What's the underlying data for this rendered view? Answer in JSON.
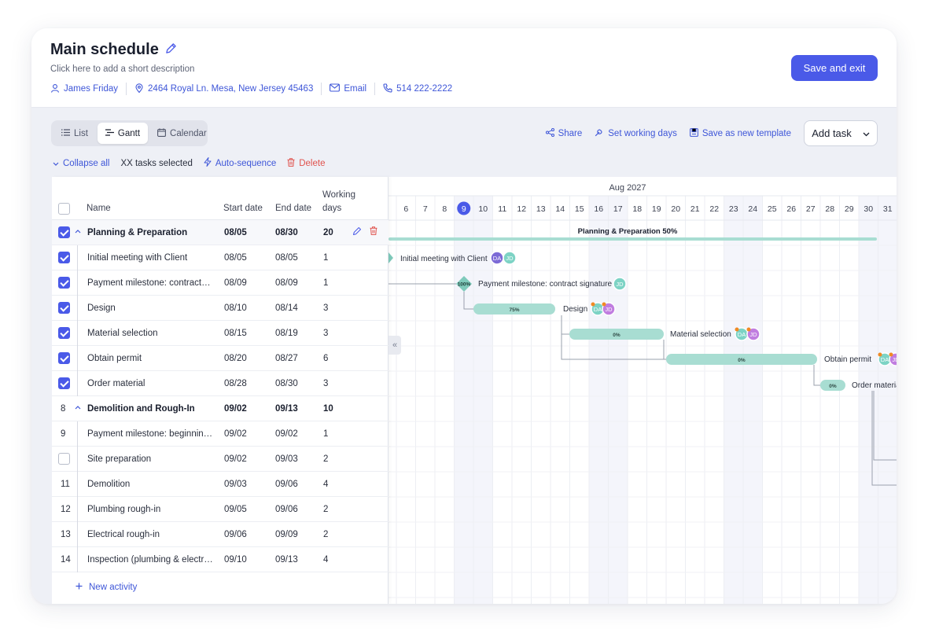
{
  "header": {
    "title": "Main schedule",
    "description": "Click here to add a short description",
    "contact_name": "James Friday",
    "address": "2464 Royal Ln. Mesa, New Jersey 45463",
    "email": "Email",
    "phone": "514 222-2222",
    "save_exit": "Save and exit"
  },
  "views": {
    "list": "List",
    "gantt": "Gantt",
    "calendar": "Calendar"
  },
  "toolbar": {
    "share": "Share",
    "working_days": "Set working days",
    "save_template": "Save as new template",
    "add_task": "Add task"
  },
  "subbar": {
    "collapse_all": "Collapse all",
    "selected": "XX tasks selected",
    "auto_sequence": "Auto-sequence",
    "delete": "Delete"
  },
  "table": {
    "col_name": "Name",
    "col_start": "Start date",
    "col_end": "End date",
    "col_working_1": "Working",
    "col_working_2": "days",
    "new_activity": "New activity",
    "rows": [
      {
        "num": "",
        "name": "Planning & Preparation",
        "start": "08/05",
        "end": "08/30",
        "days": "20"
      },
      {
        "num": "",
        "name": "Initial meeting with Client",
        "start": "08/05",
        "end": "08/05",
        "days": "1"
      },
      {
        "num": "",
        "name": "Payment milestone: contract…",
        "start": "08/09",
        "end": "08/09",
        "days": "1"
      },
      {
        "num": "",
        "name": "Design",
        "start": "08/10",
        "end": "08/14",
        "days": "3"
      },
      {
        "num": "",
        "name": "Material selection",
        "start": "08/15",
        "end": "08/19",
        "days": "3"
      },
      {
        "num": "",
        "name": "Obtain permit",
        "start": "08/20",
        "end": "08/27",
        "days": "6"
      },
      {
        "num": "",
        "name": "Order material",
        "start": "08/28",
        "end": "08/30",
        "days": "3"
      },
      {
        "num": "8",
        "name": "Demolition and Rough-In",
        "start": "09/02",
        "end": "09/13",
        "days": "10"
      },
      {
        "num": "9",
        "name": "Payment milestone: beginnin…",
        "start": "09/02",
        "end": "09/02",
        "days": "1"
      },
      {
        "num": "",
        "name": "Site preparation",
        "start": "09/02",
        "end": "09/03",
        "days": "2"
      },
      {
        "num": "11",
        "name": "Demolition",
        "start": "09/03",
        "end": "09/06",
        "days": "4"
      },
      {
        "num": "12",
        "name": "Plumbing rough-in",
        "start": "09/05",
        "end": "09/06",
        "days": "2"
      },
      {
        "num": "13",
        "name": "Electrical rough-in",
        "start": "09/06",
        "end": "09/09",
        "days": "2"
      },
      {
        "num": "14",
        "name": "Inspection (plumbing & electr…",
        "start": "09/10",
        "end": "09/13",
        "days": "4"
      }
    ]
  },
  "gantt": {
    "month": "Aug 2027",
    "days": [
      "6",
      "7",
      "8",
      "9",
      "10",
      "11",
      "12",
      "13",
      "14",
      "15",
      "16",
      "17",
      "18",
      "19",
      "20",
      "21",
      "22",
      "23",
      "24",
      "25",
      "26",
      "27",
      "28",
      "29",
      "30",
      "31"
    ],
    "today": "9",
    "group_label": "Planning & Preparation 50%",
    "tasks": [
      {
        "label": "Initial meeting with Client",
        "progress": "",
        "avatars": [
          "DA",
          "JD"
        ]
      },
      {
        "label": "Payment milestone: contract signature",
        "progress": "100%",
        "avatars": [
          "JD"
        ]
      },
      {
        "label": "Design",
        "progress": "75%",
        "avatars": [
          "DA",
          "JD"
        ]
      },
      {
        "label": "Material selection",
        "progress": "0%",
        "avatars": [
          "JD"
        ]
      },
      {
        "label": "Obtain permit",
        "progress": "0%",
        "avatars": [
          "DA"
        ]
      },
      {
        "label": "Order materia",
        "progress": "0%",
        "avatars": []
      }
    ],
    "colors": {
      "bar": "#a8ddd2",
      "bar_dark": "#7fcabb",
      "accent": "#4a5ae8",
      "avatar_da": "#7c6ad6",
      "avatar_jd": "#7dd3c5",
      "avatar_pink": "#c07de0",
      "badge": "#f08a24"
    }
  }
}
